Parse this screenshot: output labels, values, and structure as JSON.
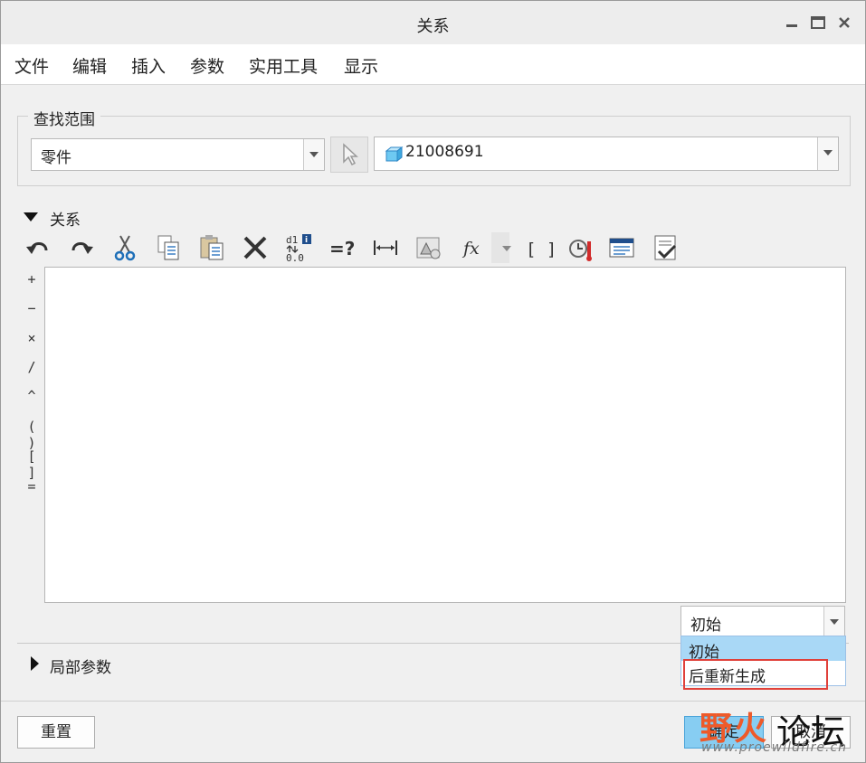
{
  "window": {
    "title": "关系"
  },
  "menu": [
    "文件",
    "编辑",
    "插入",
    "参数",
    "实用工具",
    "显示"
  ],
  "lookup": {
    "group_label": "查找范围",
    "scope_value": "零件",
    "model_value": "21008691"
  },
  "relations": {
    "section_label": "关系",
    "toolbar_icons": [
      "undo-icon",
      "redo-icon",
      "cut-icon",
      "copy-icon",
      "paste-icon",
      "delete-icon",
      "switch-dimensions-icon",
      "evaluate-icon",
      "measure-icon",
      "sort-icon",
      "insert-function-icon",
      "insert-parameter-icon",
      "execute-verify-icon",
      "insert-from-file-icon",
      "verify-icon"
    ],
    "function_label": "fx",
    "operators": [
      "+",
      "−",
      "×",
      "/",
      "^",
      "( )",
      "[ ]",
      "="
    ],
    "editor_text": ""
  },
  "regen": {
    "selected": "初始",
    "options": [
      "初始",
      "后重新生成"
    ]
  },
  "local_params": {
    "label": "局部参数"
  },
  "buttons": {
    "reset": "重置",
    "ok": "确定",
    "cancel": "取消"
  },
  "watermark": {
    "brand_a": "野火",
    "brand_b": "论坛",
    "url": "www.proewildfire.cn"
  },
  "colors": {
    "highlight": "#a9d8f6",
    "annotation_box": "#e0403a",
    "ok_button": "#87cdf2"
  }
}
